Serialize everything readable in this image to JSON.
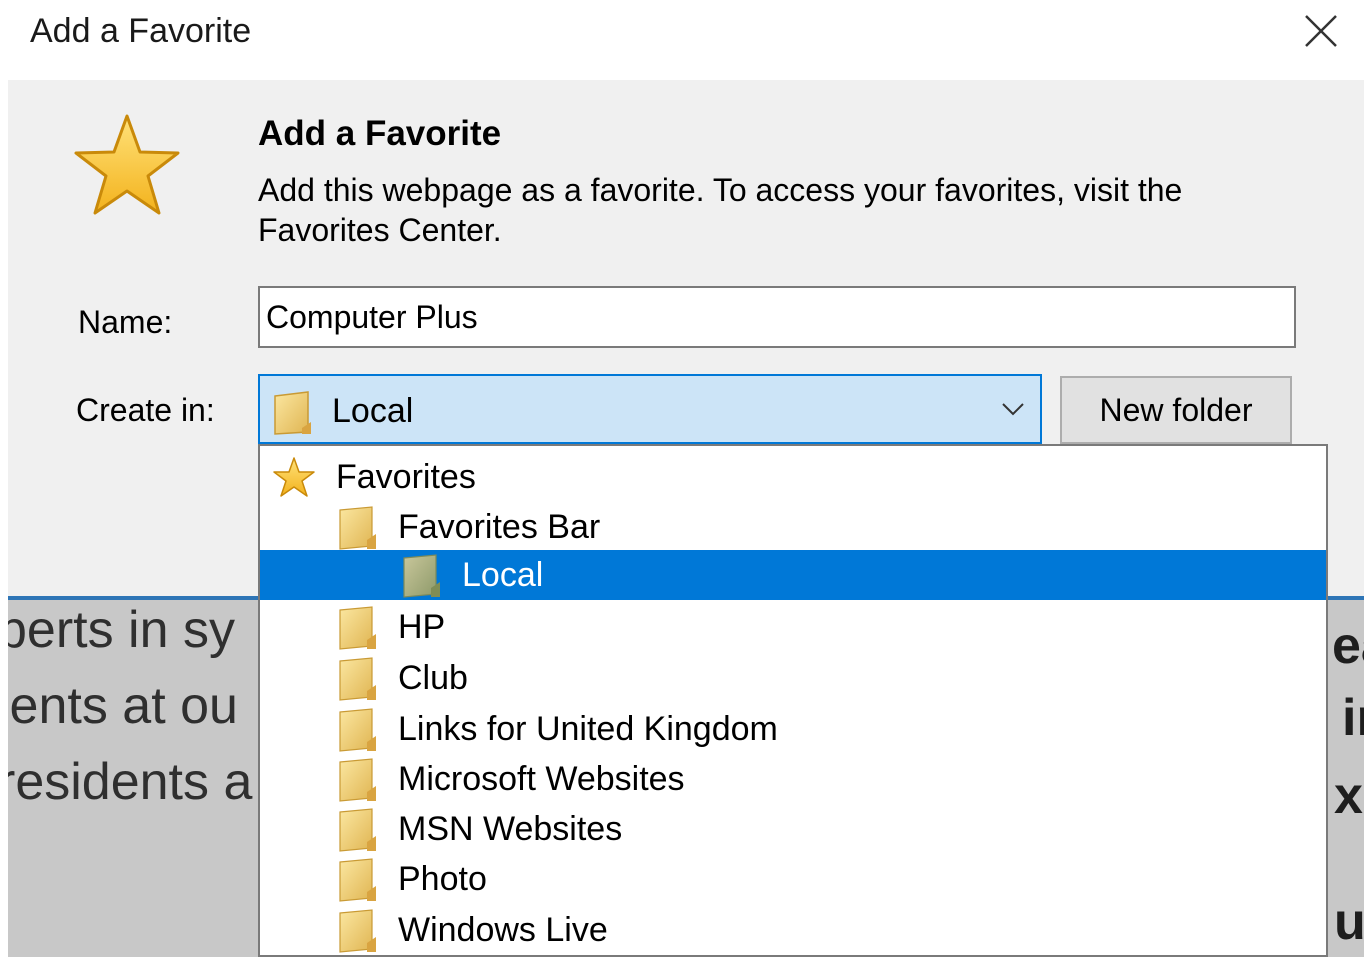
{
  "window": {
    "title": "Add a Favorite",
    "close_icon": "close-icon"
  },
  "header": {
    "heading": "Add a Favorite",
    "description": "Add this webpage as a favorite. To access your favorites, visit the Favorites Center."
  },
  "form": {
    "name_label": "Name:",
    "name_value": "Computer Plus",
    "create_in_label": "Create in:",
    "create_in_value": "Local",
    "new_folder_label": "New folder"
  },
  "dropdown": {
    "items": [
      {
        "label": "Favorites",
        "icon": "star-icon",
        "selected": false
      },
      {
        "label": "Favorites Bar",
        "icon": "folder-icon",
        "selected": false
      },
      {
        "label": "Local",
        "icon": "folder-icon",
        "selected": true
      },
      {
        "label": "HP",
        "icon": "folder-icon",
        "selected": false
      },
      {
        "label": "Club",
        "icon": "folder-icon",
        "selected": false
      },
      {
        "label": "Links for United Kingdom",
        "icon": "folder-icon",
        "selected": false
      },
      {
        "label": "Microsoft Websites",
        "icon": "folder-icon",
        "selected": false
      },
      {
        "label": "MSN Websites",
        "icon": "folder-icon",
        "selected": false
      },
      {
        "label": "Photo",
        "icon": "folder-icon",
        "selected": false
      },
      {
        "label": "Windows Live",
        "icon": "folder-icon",
        "selected": false
      }
    ]
  },
  "background_page": {
    "left_lines": [
      "perts in sy",
      "ients at ou",
      "residents a"
    ],
    "right_lines": [
      "ea",
      "in",
      "xp",
      "u"
    ]
  },
  "colors": {
    "accent": "#0078d7",
    "combo_bg": "#cce4f7",
    "dialog_bg": "#f0f0f0",
    "star": "#f7c431"
  }
}
